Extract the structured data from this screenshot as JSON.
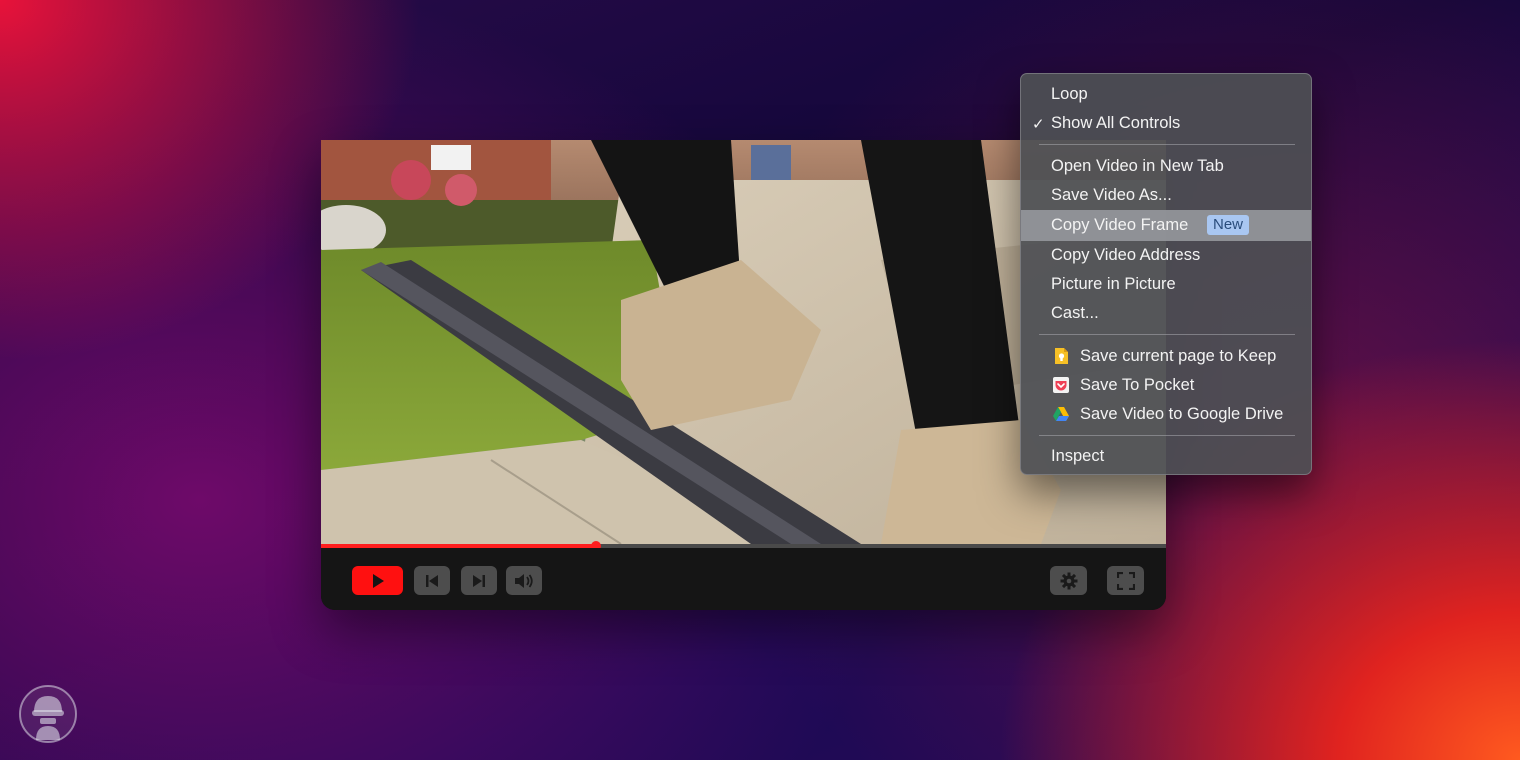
{
  "player": {
    "progress_fraction": 0.325,
    "controls": {
      "play": "play-icon",
      "previous": "skip-back-icon",
      "next": "skip-forward-icon",
      "volume": "volume-icon",
      "settings": "gear-icon",
      "fullscreen": "fullscreen-icon"
    },
    "accent_color": "#ff1010"
  },
  "context_menu": {
    "items": {
      "loop": "Loop",
      "show_all_controls": "Show All Controls",
      "show_all_controls_checked": true,
      "open_video_new_tab": "Open Video in New Tab",
      "save_video_as": "Save Video As...",
      "copy_video_frame": "Copy Video Frame",
      "copy_video_frame_badge": "New",
      "copy_video_address": "Copy Video Address",
      "picture_in_picture": "Picture in Picture",
      "cast": "Cast...",
      "save_to_keep": "Save current page to Keep",
      "save_to_pocket": "Save To Pocket",
      "save_to_drive": "Save Video to Google Drive",
      "inspect": "Inspect"
    },
    "check_mark": "✓",
    "highlighted_item": "copy_video_frame"
  }
}
